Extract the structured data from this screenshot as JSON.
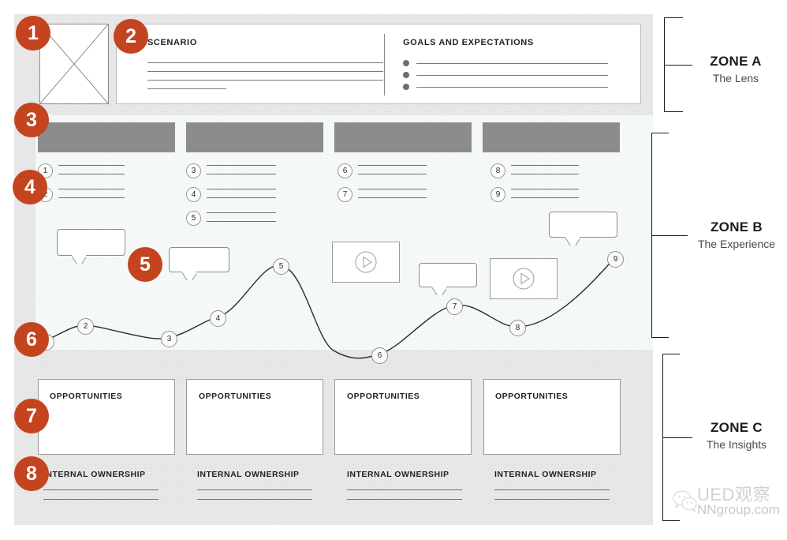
{
  "zoneA": {
    "scenario_title": "SCENARIO",
    "goals_title": "GOALS AND EXPECTATIONS",
    "scenario_line_count": 4,
    "goal_bullet_count": 3
  },
  "zoneB": {
    "columns": [
      {
        "id": "phase-1",
        "items": [
          "1",
          "2"
        ]
      },
      {
        "id": "phase-2",
        "items": [
          "3",
          "4",
          "5"
        ]
      },
      {
        "id": "phase-3",
        "items": [
          "6",
          "7"
        ]
      },
      {
        "id": "phase-4",
        "items": [
          "8",
          "9"
        ]
      }
    ],
    "curve_nodes": [
      "1",
      "2",
      "3",
      "4",
      "5",
      "6",
      "7",
      "8",
      "9"
    ],
    "quote_bubble_count": 4,
    "video_count": 2,
    "video_icon": "play-icon"
  },
  "zoneC": {
    "columns": [
      {
        "opportunities_title": "OPPORTUNITIES",
        "ownership_title": "INTERNAL OWNERSHIP"
      },
      {
        "opportunities_title": "OPPORTUNITIES",
        "ownership_title": "INTERNAL OWNERSHIP"
      },
      {
        "opportunities_title": "OPPORTUNITIES",
        "ownership_title": "INTERNAL OWNERSHIP"
      },
      {
        "opportunities_title": "OPPORTUNITIES",
        "ownership_title": "INTERNAL OWNERSHIP"
      }
    ]
  },
  "zones": [
    {
      "key": "a",
      "title": "ZONE A",
      "subtitle": "The Lens"
    },
    {
      "key": "b",
      "title": "ZONE B",
      "subtitle": "The Experience"
    },
    {
      "key": "c",
      "title": "ZONE C",
      "subtitle": "The Insights"
    }
  ],
  "callouts": [
    {
      "n": "1"
    },
    {
      "n": "2"
    },
    {
      "n": "3"
    },
    {
      "n": "4"
    },
    {
      "n": "5"
    },
    {
      "n": "6"
    },
    {
      "n": "7"
    },
    {
      "n": "8"
    }
  ],
  "watermark": {
    "main": "UED观察",
    "sub": "NNgroup.com",
    "icon": "wechat-icon"
  },
  "colors": {
    "accent": "#c4441f",
    "header_block": "#8c8c8c",
    "frame": "#e8e8e8",
    "panel": "#f6f9f9",
    "ink": "#231f20"
  }
}
